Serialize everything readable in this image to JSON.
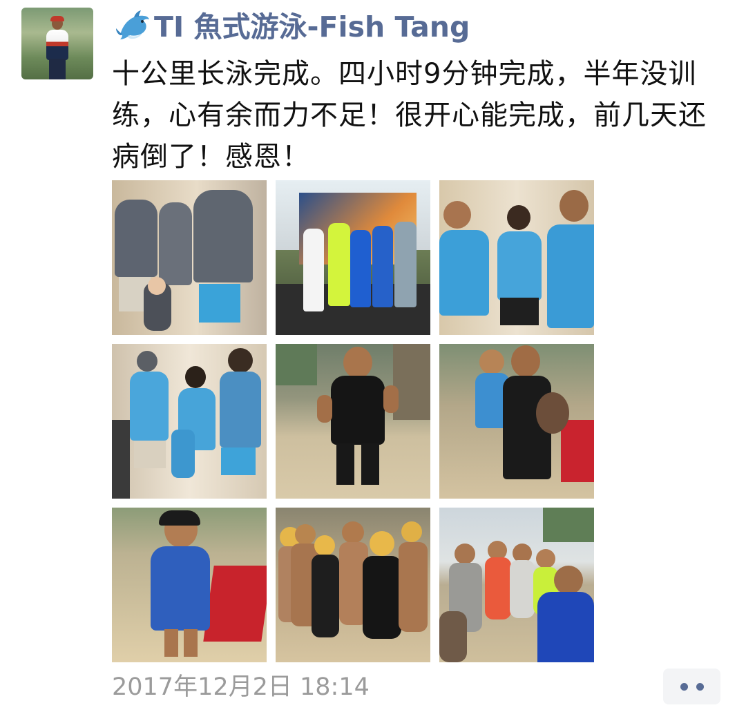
{
  "post": {
    "author": {
      "name": "TI 魚式游泳-Fish Tang",
      "avatar_icon": "avatar-photo",
      "name_prefix_icon": "dolphin-icon"
    },
    "text": "十公里长泳完成。四小时9分钟完成，半年没训练，心有余而力不足！很开心能完成，前几天还病倒了！感恩！",
    "photos": [
      {
        "icon": "photo-group-hooded-jackets"
      },
      {
        "icon": "photo-group-at-event-banner"
      },
      {
        "icon": "photo-three-with-medals"
      },
      {
        "icon": "photo-family-posing"
      },
      {
        "icon": "photo-swimmer-wetsuit"
      },
      {
        "icon": "photo-man-holding-child"
      },
      {
        "icon": "photo-child-on-beach"
      },
      {
        "icon": "photo-swimmers-group-beach"
      },
      {
        "icon": "photo-group-on-beach"
      }
    ],
    "timestamp": "2017年12月2日 18:14",
    "more_icon": "more-dots-icon"
  },
  "colors": {
    "name": "#576b95",
    "text": "#111111",
    "timestamp": "#9b9b9b",
    "more_bg": "#f3f4f6"
  }
}
